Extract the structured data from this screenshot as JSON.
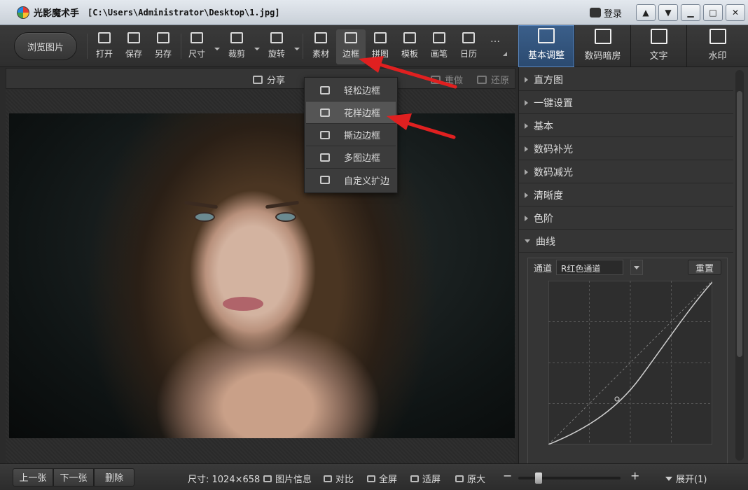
{
  "titlebar": {
    "app_name": "光影魔术手",
    "file_path": "[C:\\Users\\Administrator\\Desktop\\1.jpg]",
    "login_label": "登录"
  },
  "toolbar": {
    "browse_label": "浏览图片",
    "tools": [
      {
        "label": "打开",
        "icon": "image-open-icon"
      },
      {
        "label": "保存",
        "icon": "save-icon"
      },
      {
        "label": "另存",
        "icon": "save-as-icon"
      },
      {
        "label": "尺寸",
        "icon": "resize-icon"
      },
      {
        "label": "裁剪",
        "icon": "crop-icon"
      },
      {
        "label": "旋转",
        "icon": "rotate-icon"
      },
      {
        "label": "素材",
        "icon": "sticker-icon"
      },
      {
        "label": "边框",
        "icon": "frame-icon"
      },
      {
        "label": "拼图",
        "icon": "collage-icon"
      },
      {
        "label": "模板",
        "icon": "template-icon"
      },
      {
        "label": "画笔",
        "icon": "brush-icon"
      },
      {
        "label": "日历",
        "icon": "calendar-icon"
      }
    ],
    "more_label": "…",
    "right_tabs": [
      {
        "label": "基本调整",
        "icon": "adjust-icon"
      },
      {
        "label": "数码暗房",
        "icon": "darkroom-icon"
      },
      {
        "label": "文字",
        "icon": "text-icon"
      },
      {
        "label": "水印",
        "icon": "watermark-icon"
      }
    ]
  },
  "subbar": {
    "share_label": "分享",
    "redo_label": "重做",
    "restore_label": "还原"
  },
  "frame_menu": {
    "items": [
      {
        "label": "轻松边框",
        "icon": "simple-frame-icon"
      },
      {
        "label": "花样边框",
        "icon": "fancy-frame-icon"
      },
      {
        "label": "撕边边框",
        "icon": "torn-frame-icon"
      },
      {
        "label": "多图边框",
        "icon": "multi-frame-icon"
      },
      {
        "label": "自定义扩边",
        "icon": "custom-border-icon"
      }
    ]
  },
  "panel": {
    "sections": [
      "直方图",
      "一键设置",
      "基本",
      "数码补光",
      "数码减光",
      "清晰度",
      "色阶",
      "曲线"
    ],
    "curves": {
      "channel_label": "通道",
      "channel_value": "R红色通道",
      "reset_label": "重置"
    }
  },
  "bottombar": {
    "prev_label": "上一张",
    "next_label": "下一张",
    "delete_label": "删除",
    "size_text": "尺寸: 1024×658",
    "info_label": "图片信息",
    "compare_label": "对比",
    "fullscreen_label": "全屏",
    "fit_label": "适屏",
    "original_label": "原大",
    "zoom_minus": "−",
    "zoom_plus": "+",
    "zoom_level": 0.2,
    "expand_label": "展开(1)"
  },
  "colors": {
    "accent": "#3b5f8a",
    "annotation": "#e02020"
  }
}
